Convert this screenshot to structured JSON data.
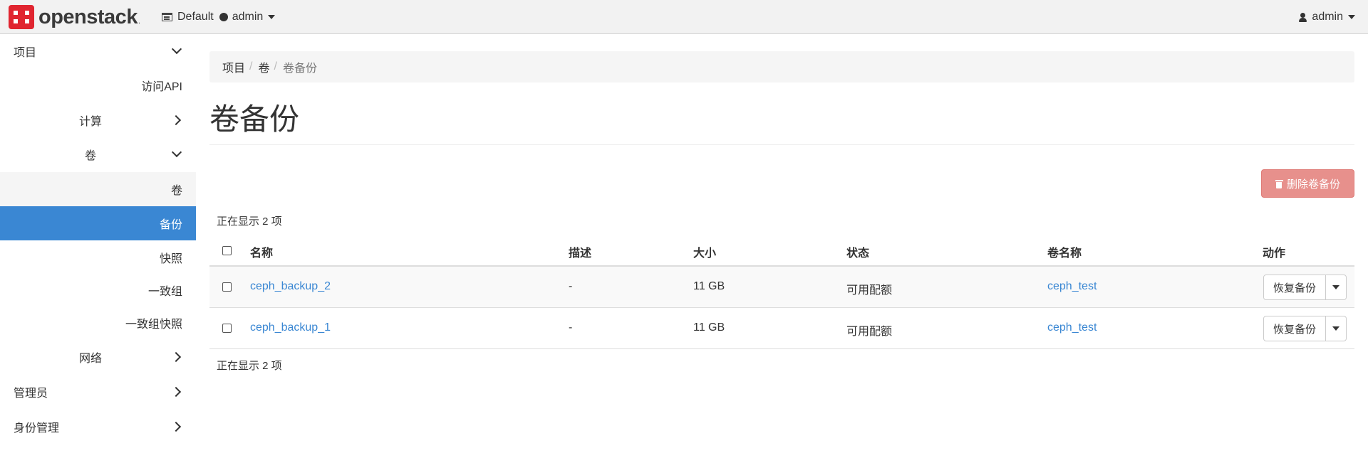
{
  "header": {
    "logo_text": "openstack",
    "logo_suffix": ".",
    "domain": "Default",
    "project": "admin",
    "user": "admin"
  },
  "sidebar": {
    "project": "项目",
    "api_access": "访问API",
    "compute": "计算",
    "volumes_group": "卷",
    "volumes": "卷",
    "backups": "备份",
    "snapshots": "快照",
    "consistency_groups": "一致组",
    "cg_snapshots": "一致组快照",
    "network": "网络",
    "admin": "管理员",
    "identity": "身份管理"
  },
  "breadcrumb": {
    "items": [
      "项目",
      "卷",
      "卷备份"
    ],
    "separator": "/"
  },
  "page": {
    "title": "卷备份",
    "delete_button": "删除卷备份",
    "count_top": "正在显示 2 项",
    "count_bottom": "正在显示 2 项"
  },
  "table": {
    "columns": [
      "名称",
      "描述",
      "大小",
      "状态",
      "卷名称",
      "动作"
    ],
    "rows": [
      {
        "name": "ceph_backup_2",
        "description": "-",
        "size": "11 GB",
        "status": "可用配额",
        "volume": "ceph_test",
        "action": "恢复备份"
      },
      {
        "name": "ceph_backup_1",
        "description": "-",
        "size": "11 GB",
        "status": "可用配额",
        "volume": "ceph_test",
        "action": "恢复备份"
      }
    ]
  },
  "colors": {
    "active_nav": "#3a87d3",
    "link": "#3a87d3",
    "danger_disabled": "#e7908c",
    "brand_red": "#e02530"
  }
}
